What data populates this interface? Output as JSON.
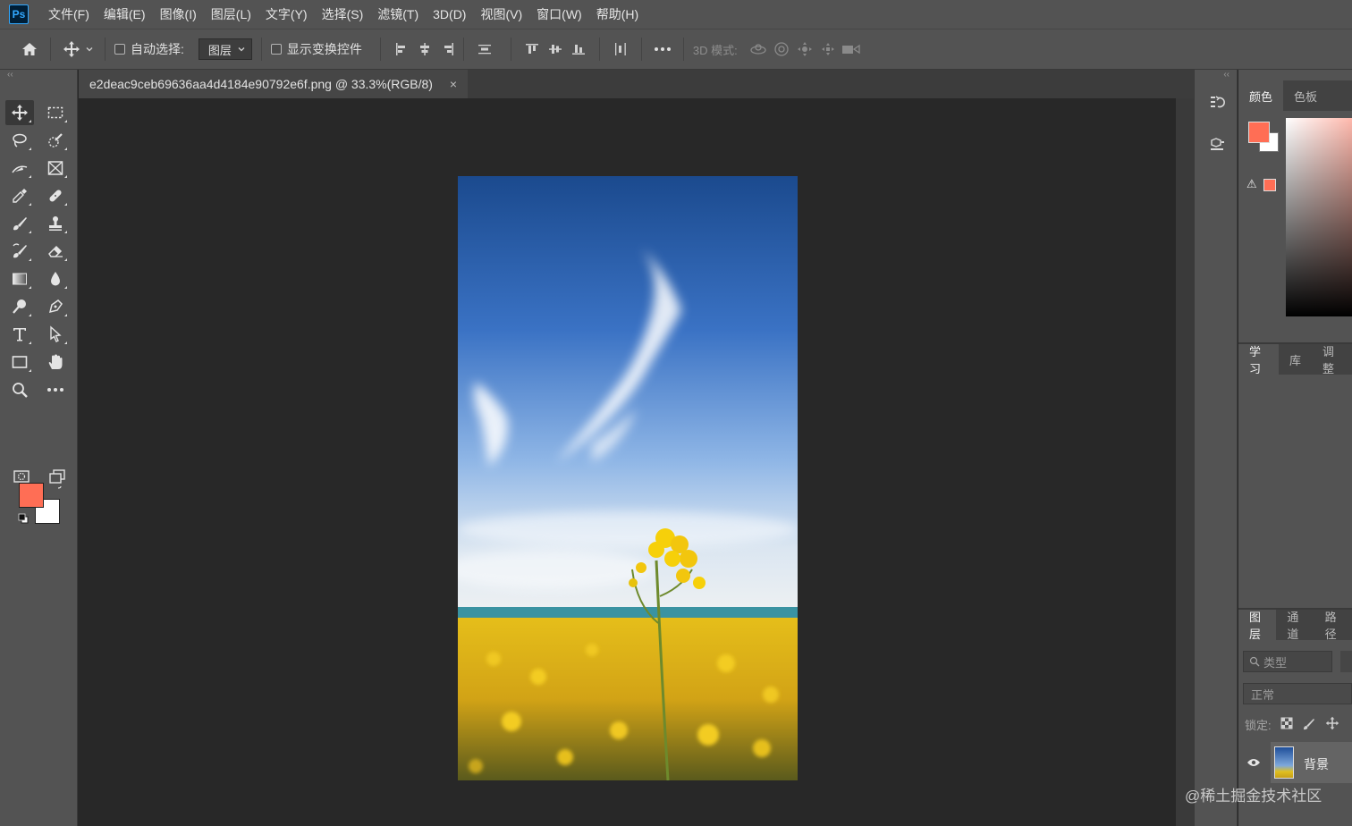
{
  "app": {
    "logo": "Ps"
  },
  "menu": [
    "文件(F)",
    "编辑(E)",
    "图像(I)",
    "图层(L)",
    "文字(Y)",
    "选择(S)",
    "滤镜(T)",
    "3D(D)",
    "视图(V)",
    "窗口(W)",
    "帮助(H)"
  ],
  "options": {
    "auto_select_label": "自动选择:",
    "auto_select_value": "图层",
    "show_transform_label": "显示变换控件",
    "mode_3d_label": "3D 模式:"
  },
  "document": {
    "tab_title": "e2deac9ceb69636aa4d4184e90792e6f.png @ 33.3%(RGB/8)",
    "close_glyph": "×"
  },
  "colors": {
    "foreground": "#ff6e55",
    "background": "#ffffff"
  },
  "panels": {
    "color_tabs": [
      "颜色",
      "色板"
    ],
    "learn_tabs": [
      "学习",
      "库",
      "调整"
    ],
    "layer_tabs": [
      "图层",
      "通道",
      "路径"
    ],
    "layer_search_placeholder": "类型",
    "blend_mode": "正常",
    "lock_label": "锁定:",
    "layer_name": "背景",
    "gamut_warning": "⚠"
  },
  "watermark": "@稀土掘金技术社区"
}
